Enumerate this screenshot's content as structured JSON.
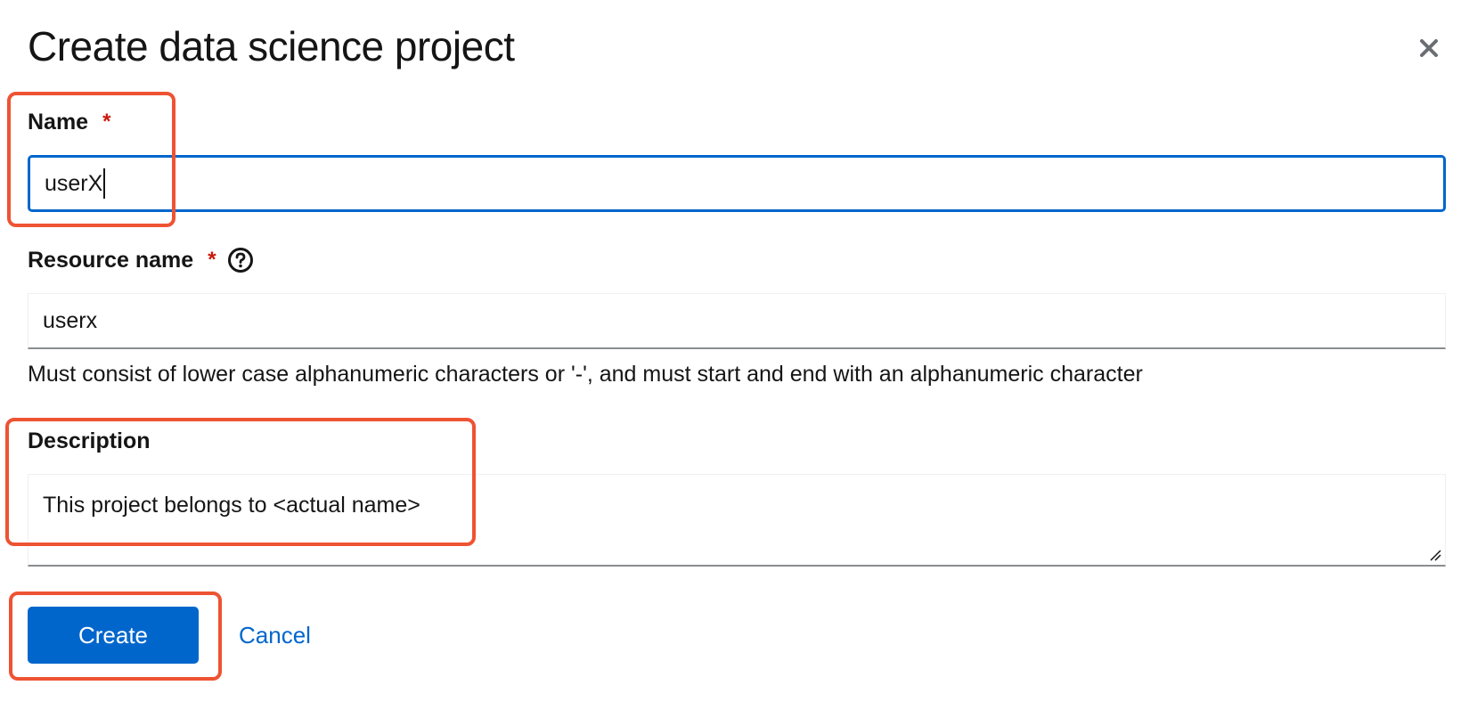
{
  "modal": {
    "title": "Create data science project",
    "close_icon": "close-icon"
  },
  "form": {
    "name": {
      "label": "Name",
      "required_mark": "*",
      "value": "userX"
    },
    "resource_name": {
      "label": "Resource name",
      "required_mark": "*",
      "help_icon": "question-circle-icon",
      "value": "userx",
      "helper_text": "Must consist of lower case alphanumeric characters or '-', and must start and end with an alphanumeric character"
    },
    "description": {
      "label": "Description",
      "value": "This project belongs to <actual name>"
    }
  },
  "actions": {
    "create_label": "Create",
    "cancel_label": "Cancel"
  },
  "colors": {
    "primary": "#0066cc",
    "required": "#c9190b",
    "highlight": "#ee5333",
    "text": "#151515"
  }
}
